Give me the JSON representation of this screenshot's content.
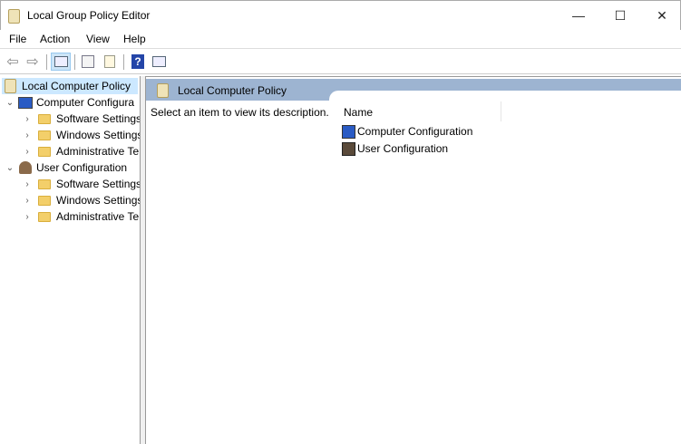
{
  "window": {
    "title": "Local Group Policy Editor",
    "minimize": "—",
    "maximize": "☐",
    "close": "✕"
  },
  "menu": [
    "File",
    "Action",
    "View",
    "Help"
  ],
  "toolbar": [
    "back-icon",
    "forward-icon",
    "show-hide-console-tree-icon",
    "properties-icon",
    "export-list-icon",
    "help-icon",
    "show-action-pane-icon"
  ],
  "tree": {
    "root": "Local Computer Policy",
    "computer": {
      "label": "Computer Configura",
      "children": [
        "Software Settings",
        "Windows Settings",
        "Administrative Te"
      ]
    },
    "user": {
      "label": "User Configuration",
      "children": [
        "Software Settings",
        "Windows Settings",
        "Administrative Te"
      ]
    }
  },
  "main": {
    "header": "Local Computer Policy",
    "description": "Select an item to view its description.",
    "column": "Name",
    "items": [
      "Computer Configuration",
      "User Configuration"
    ]
  }
}
